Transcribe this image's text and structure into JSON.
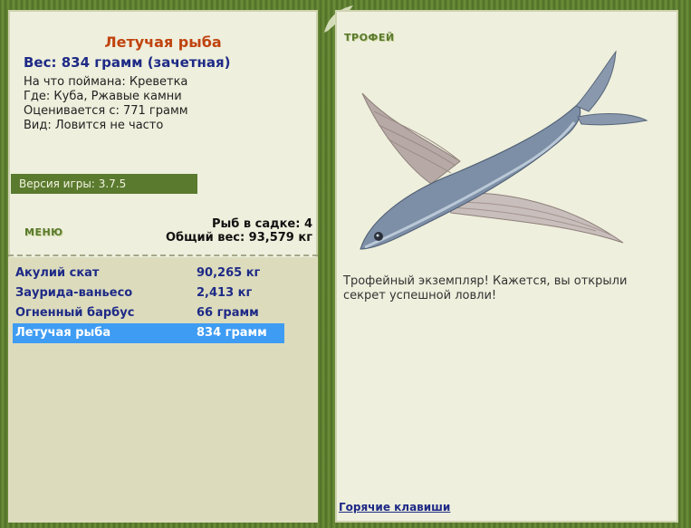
{
  "fish": {
    "title": "Летучая рыба",
    "weight_line": "Вес: 834 грамм (зачетная)",
    "bait_line": "На что поймана: Креветка",
    "place_line": "Где: Куба, Ржавые камни",
    "rated_line": "Оценивается с: 771 грамм",
    "kind_line": "Вид: Ловится не часто"
  },
  "version": "Версия игры: 3.7.5",
  "menu_label": "МЕНЮ",
  "stats": {
    "count_line": "Рыб в садке: 4",
    "total_line": "Общий вес: 93,579 кг"
  },
  "catch_list": [
    {
      "name": "Акулий скат",
      "weight": "90,265 кг",
      "selected": false
    },
    {
      "name": "Заурида-ваньесо",
      "weight": "2,413 кг",
      "selected": false
    },
    {
      "name": "Огненный барбус",
      "weight": "66 грамм",
      "selected": false
    },
    {
      "name": "Летучая рыба",
      "weight": "834 грамм",
      "selected": true
    }
  ],
  "trophy": {
    "label": "ТРОФЕЙ",
    "text": "Трофейный экземпляр! Кажется, вы открыли секрет успешной ловли!"
  },
  "hotkeys_label": "Горячие клавиши",
  "colors": {
    "frame": "#5a7a2e",
    "panel": "#eeefdc",
    "list_bg": "#dcdcbd",
    "selected": "#3f9cf3",
    "title": "#c0430f",
    "link": "#1e2a86"
  }
}
